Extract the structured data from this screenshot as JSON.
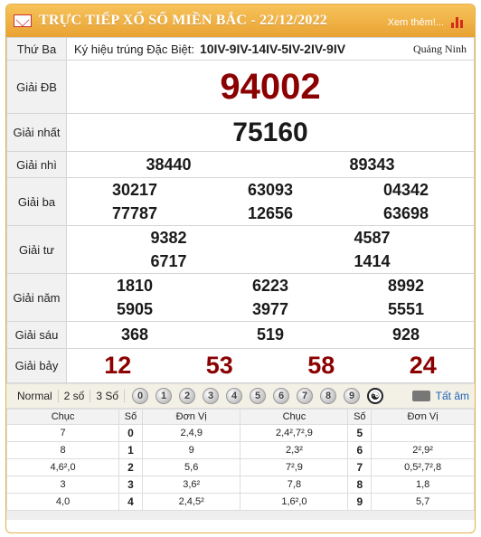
{
  "header": {
    "title": "TRỰC TIẾP XỔ SỐ MIỀN BẮC - 22/12/2022",
    "more": "Xem thêm!..."
  },
  "info": {
    "weekday": "Thứ Ba",
    "code_label": "Ký hiệu trúng Đặc Biệt:",
    "code_value": "10IV-9IV-14IV-5IV-2IV-9IV",
    "province": "Quảng Ninh"
  },
  "prizes": {
    "db": {
      "label": "Giải ĐB",
      "values": [
        "94002"
      ]
    },
    "g1": {
      "label": "Giải nhất",
      "values": [
        "75160"
      ]
    },
    "g2": {
      "label": "Giải nhì",
      "values": [
        "38440",
        "89343"
      ]
    },
    "g3": {
      "label": "Giải ba",
      "values": [
        "30217",
        "63093",
        "04342",
        "77787",
        "12656",
        "63698"
      ]
    },
    "g4": {
      "label": "Giải tư",
      "values": [
        "9382",
        "4587",
        "6717",
        "1414"
      ]
    },
    "g5": {
      "label": "Giải năm",
      "values": [
        "1810",
        "6223",
        "8992",
        "5905",
        "3977",
        "5551"
      ]
    },
    "g6": {
      "label": "Giải sáu",
      "values": [
        "368",
        "519",
        "928"
      ]
    },
    "g7": {
      "label": "Giải bảy",
      "values": [
        "12",
        "53",
        "58",
        "24"
      ]
    }
  },
  "controls": {
    "options": [
      "Normal",
      "2 số",
      "3 Số"
    ],
    "digits": [
      "0",
      "1",
      "2",
      "3",
      "4",
      "5",
      "6",
      "7",
      "8",
      "9"
    ],
    "all_label": "Tất âm"
  },
  "loto": {
    "headers": [
      "Chục",
      "Số",
      "Đơn Vị",
      "Chục",
      "Số",
      "Đơn Vị"
    ],
    "rows": [
      [
        "7",
        "0",
        "2,4,9",
        "2,4²,7²,9",
        "5",
        ""
      ],
      [
        "8",
        "1",
        "9",
        "2,3²",
        "6",
        "2²,9²"
      ],
      [
        "4,6²,0",
        "2",
        "5,6",
        "7²,9",
        "7",
        "0,5²,7²,8"
      ],
      [
        "3",
        "3",
        "3,6²",
        "7,8",
        "8",
        "1,8"
      ],
      [
        "4,0",
        "4",
        "2,4,5²",
        "1,6²,0",
        "9",
        "5,7"
      ]
    ]
  },
  "colors": {
    "header": "#e9a233",
    "prize_red": "#8b0000",
    "link": "#1b62b8"
  }
}
